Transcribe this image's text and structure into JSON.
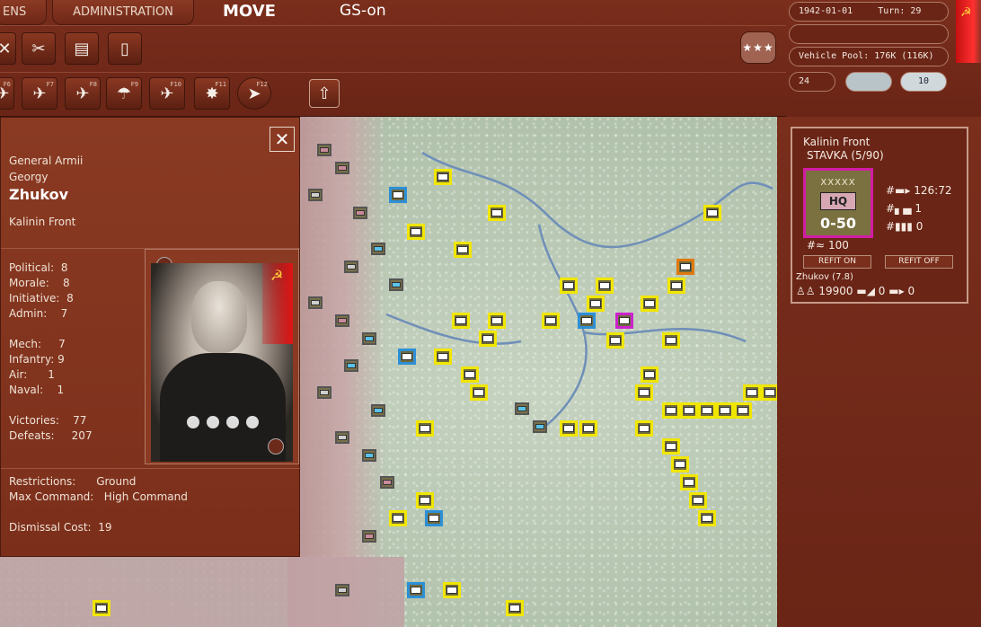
{
  "tabs": {
    "left": "ENS",
    "administration": "ADMINISTRATION"
  },
  "modes": {
    "move": "MOVE",
    "gs": "GS-on"
  },
  "toolbar_row1": [
    {
      "icon": "cancel-icon"
    },
    {
      "icon": "artillery-icon"
    },
    {
      "icon": "rail-icon"
    },
    {
      "icon": "document-icon"
    }
  ],
  "toolbar_row2": [
    {
      "key": "F6",
      "icon": "airbase-icon"
    },
    {
      "key": "F7",
      "icon": "air-attack-icon"
    },
    {
      "key": "F8",
      "icon": "bombing-icon"
    },
    {
      "key": "F9",
      "icon": "paradrop-icon"
    },
    {
      "key": "F10",
      "icon": "interdiction-icon"
    },
    {
      "key": "F11",
      "icon": "explosion-icon"
    },
    {
      "key": "F12",
      "icon": "target-icon"
    }
  ],
  "stars_button": "★★★",
  "status": {
    "date": "1942-01-01",
    "turn": "Turn: 29",
    "vehicle_pool": "Vehicle Pool: 176K (116K)",
    "value_left": "24",
    "value_right": "10"
  },
  "leader": {
    "rank": "General Armii",
    "first_name": "Georgy",
    "last_name": "Zhukov",
    "command": "Kalinin Front",
    "stats": [
      {
        "label": "Political:",
        "value": "8"
      },
      {
        "label": "Morale:",
        "value": "8"
      },
      {
        "label": "Initiative:",
        "value": "8"
      },
      {
        "label": "Admin:",
        "value": "7"
      }
    ],
    "skills": [
      {
        "label": "Mech:",
        "value": "7"
      },
      {
        "label": "Infantry:",
        "value": "9"
      },
      {
        "label": "Air:",
        "value": "1"
      },
      {
        "label": "Naval:",
        "value": "1"
      }
    ],
    "record": [
      {
        "label": "Victories:",
        "value": "77"
      },
      {
        "label": "Defeats:",
        "value": "207"
      }
    ],
    "restrictions_label": "Restrictions:",
    "restrictions_value": "Ground",
    "max_command_label": "Max Command:",
    "max_command_value": "High Command",
    "dismissal_label": "Dismissal Cost:",
    "dismissal_value": "19"
  },
  "unit": {
    "name": "Kalinin Front",
    "hq": "STAVKA  (5/90)",
    "size": "XXXXX",
    "type": "HQ",
    "strength": "0-50",
    "tanks": "126:72",
    "guns": "1",
    "afv": "0",
    "supply": "100",
    "refit_on": "REFIT ON",
    "refit_off": "REFIT OFF",
    "commander": "Zhukov (7.8)",
    "men": "19900",
    "artillery": "0",
    "armor": "0"
  },
  "colors": {
    "panel": "#7b2f1b",
    "highlight_friendly": "#f1e600",
    "hq_selected": "#d21ca6"
  }
}
